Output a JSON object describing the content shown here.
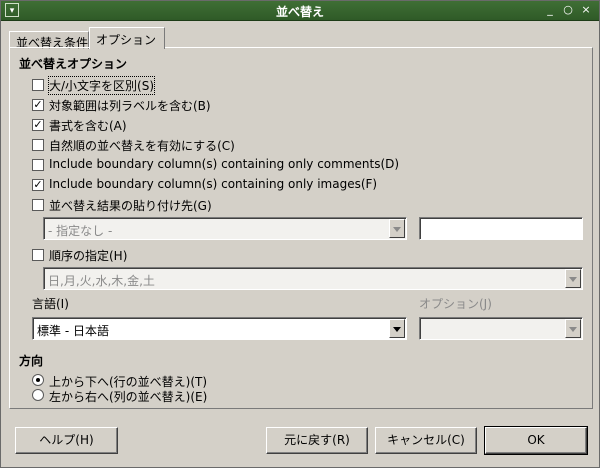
{
  "window": {
    "title": "並べ替え"
  },
  "tabs": [
    {
      "label": "並べ替え条件"
    },
    {
      "label": "オプション"
    }
  ],
  "options_section": {
    "title": "並べ替えオプション"
  },
  "checkboxes": [
    {
      "label": "大/小文字を区別(S)",
      "checked": false
    },
    {
      "label": "対象範囲は列ラベルを含む(B)",
      "checked": true
    },
    {
      "label": "書式を含む(A)",
      "checked": true
    },
    {
      "label": "自然順の並べ替えを有効にする(C)",
      "checked": false
    },
    {
      "label": "Include boundary column(s) containing only comments(D)",
      "checked": false
    },
    {
      "label": "Include boundary column(s) containing only images(F)",
      "checked": true
    },
    {
      "label": "並べ替え結果の貼り付け先(G)",
      "checked": false
    }
  ],
  "copy_result": {
    "dropdown_value": "- 指定なし -",
    "text_value": ""
  },
  "custom_order": {
    "label": "順序の指定(H)",
    "checked": false,
    "dropdown_value": "日,月,火,水,木,金,土"
  },
  "language": {
    "label": "言語(I)",
    "value": "標準 - 日本語"
  },
  "language_options": {
    "label": "オプション(J)",
    "value": ""
  },
  "direction_section": {
    "title": "方向"
  },
  "direction": [
    {
      "label": "上から下へ(行の並べ替え)(T)",
      "selected": true
    },
    {
      "label": "左から右へ(列の並べ替え)(E)",
      "selected": false
    }
  ],
  "buttons": {
    "help": "ヘルプ(H)",
    "reset": "元に戻す(R)",
    "cancel": "キャンセル(C)",
    "ok": "OK"
  },
  "icons": {
    "window_menu": "window-menu-icon",
    "minimize": "minimize-icon",
    "maximize": "maximize-icon",
    "close": "close-icon"
  }
}
